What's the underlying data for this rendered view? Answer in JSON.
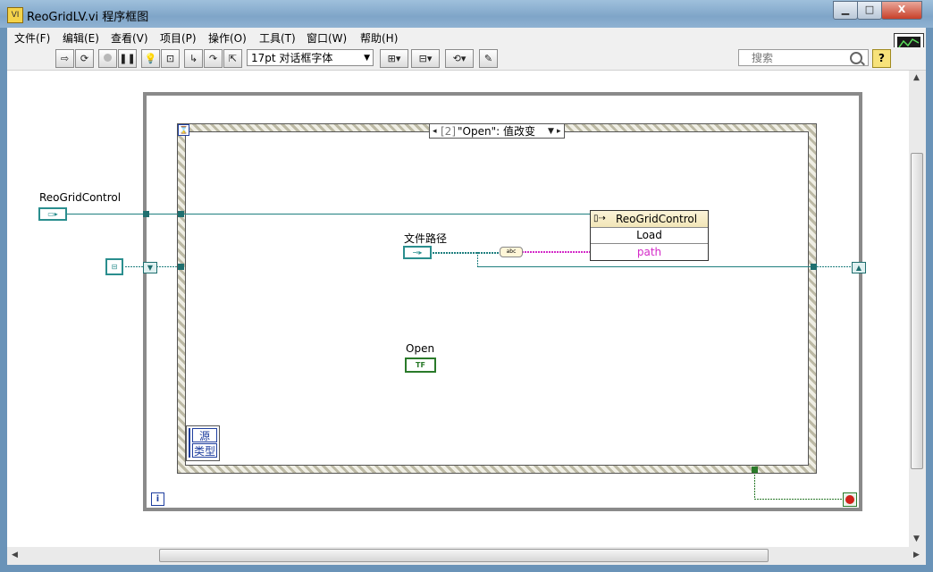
{
  "window": {
    "title": "ReoGridLV.vi 程序框图",
    "min_label": "▁",
    "max_label": "□",
    "close_label": "X"
  },
  "menu": [
    "文件(F)",
    "编辑(E)",
    "查看(V)",
    "项目(P)",
    "操作(O)",
    "工具(T)",
    "窗口(W)",
    "帮助(H)"
  ],
  "toolbar": {
    "run_icon": "run-arrow-icon",
    "font_value": "17pt 对话框字体",
    "search_placeholder": "搜索",
    "help_label": "?"
  },
  "diagram": {
    "event_case": {
      "index": "[2]",
      "name": "\"Open\": 值改变"
    },
    "event_data": {
      "source": "源",
      "type": "类型"
    },
    "labels": {
      "reogrid_control": "ReoGridControl",
      "file_path": "文件路径",
      "open": "Open"
    },
    "invoke_node": {
      "class": "ReoGridControl",
      "method": "Load",
      "param": "path"
    },
    "bool_text": "TF",
    "iteration": "i",
    "to_string_text": "abc"
  }
}
